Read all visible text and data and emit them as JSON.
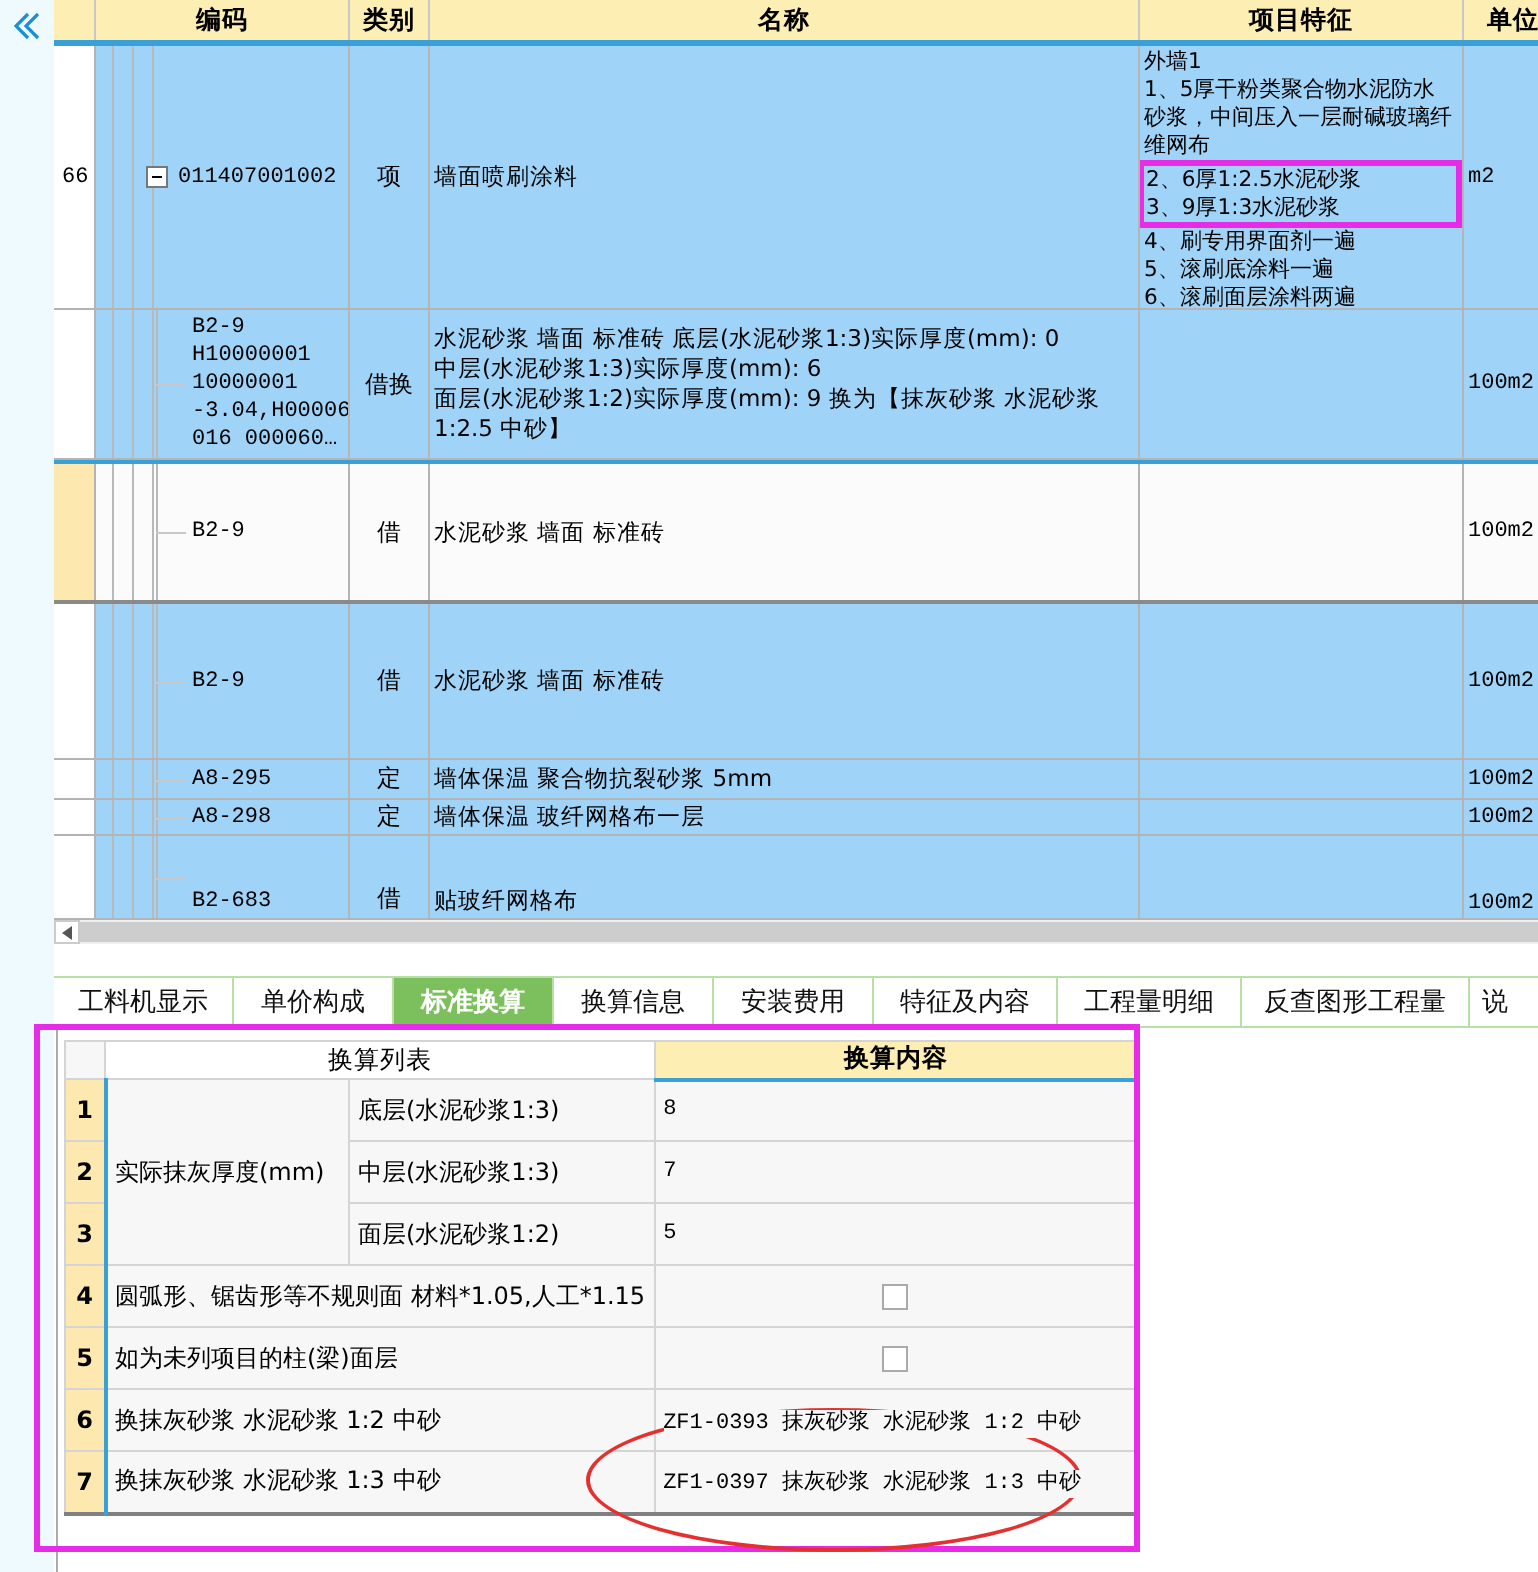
{
  "grid": {
    "columns": [
      "编码",
      "类别",
      "名称",
      "项目特征",
      "单位"
    ],
    "rows": [
      {
        "number": "66",
        "code": "011407001002",
        "type": "项",
        "name": "墙面喷刷涂料",
        "unit": "m2",
        "expanded": true,
        "current": false,
        "features": [
          {
            "text": "外墙1",
            "highlighted": false
          },
          {
            "text": "1、5厚干粉类聚合物水泥防水砂浆，中间压入一层耐碱玻璃纤维网布",
            "highlighted": false
          },
          {
            "text": "2、6厚1:2.5水泥砂浆",
            "highlighted": true
          },
          {
            "text": "3、9厚1:3水泥砂浆",
            "highlighted": true
          },
          {
            "text": "4、刷专用界面剂一遍",
            "highlighted": false
          },
          {
            "text": "5、滚刷底涂料一遍",
            "highlighted": false
          },
          {
            "text": "6、滚刷面层涂料两遍",
            "highlighted": false
          }
        ],
        "children": [
          {
            "code": "B2-9\nH10000001\n10000001\n-3.04,H00006\n016 000060…",
            "type": "借换",
            "name": "水泥砂浆 墙面 标准砖  底层(水泥砂浆1:3)实际厚度(mm): 0\n中层(水泥砂浆1:3)实际厚度(mm): 6\n面层(水泥砂浆1:2)实际厚度(mm): 9  换为【抹灰砂浆 水泥砂浆\n1:2.5 中砂】",
            "unit": "100m2",
            "current": false
          },
          {
            "code": "B2-9",
            "type": "借",
            "name": "水泥砂浆 墙面 标准砖",
            "unit": "100m2",
            "current": true
          },
          {
            "code": "B2-9",
            "type": "借",
            "name": "水泥砂浆 墙面 标准砖",
            "unit": "100m2",
            "current": false
          },
          {
            "code": "A8-295",
            "type": "定",
            "name": "墙体保温 聚合物抗裂砂浆 5mm",
            "unit": "100m2",
            "current": false
          },
          {
            "code": "A8-298",
            "type": "定",
            "name": "墙体保温 玻纤网格布一层",
            "unit": "100m2",
            "current": false
          },
          {
            "code": "B2-683",
            "type": "借",
            "name": "贴玻纤网格布",
            "unit": "100m2",
            "current": false
          }
        ]
      }
    ]
  },
  "tabs": [
    {
      "label": "工料机显示",
      "selected": false
    },
    {
      "label": "单价构成",
      "selected": false
    },
    {
      "label": "标准换算",
      "selected": true
    },
    {
      "label": "换算信息",
      "selected": false
    },
    {
      "label": "安装费用",
      "selected": false
    },
    {
      "label": "特征及内容",
      "selected": false
    },
    {
      "label": "工程量明细",
      "selected": false
    },
    {
      "label": "反查图形工程量",
      "selected": false
    },
    {
      "label": "说",
      "selected": false
    }
  ],
  "conversion": {
    "columns": [
      {
        "label": "换算列表",
        "selected": false
      },
      {
        "label": "换算内容",
        "selected": true
      }
    ],
    "rows": [
      {
        "kind": "group",
        "label": "实际抹灰厚度(mm)",
        "children": [
          {
            "number": "1",
            "label": "底层(水泥砂浆1:3)",
            "value": "8"
          },
          {
            "number": "2",
            "label": "中层(水泥砂浆1:3)",
            "value": "7"
          },
          {
            "number": "3",
            "label": "面层(水泥砂浆1:2)",
            "value": "5"
          }
        ]
      },
      {
        "kind": "checkbox",
        "number": "4",
        "label": "圆弧形、锯齿形等不规则面 材料*1.05,人工*1.15",
        "checked": false
      },
      {
        "kind": "checkbox",
        "number": "5",
        "label": "如为未列项目的柱(梁)面层",
        "checked": false
      },
      {
        "kind": "value",
        "number": "6",
        "label": "换抹灰砂浆 水泥砂浆 1:2 中砂",
        "value": "ZF1-0393  抹灰砂浆 水泥砂浆 1:2 中砂"
      },
      {
        "kind": "value",
        "number": "7",
        "label": "换抹灰砂浆 水泥砂浆 1:3 中砂",
        "value": "ZF1-0397  抹灰砂浆 水泥砂浆 1:3 中砂"
      }
    ]
  }
}
